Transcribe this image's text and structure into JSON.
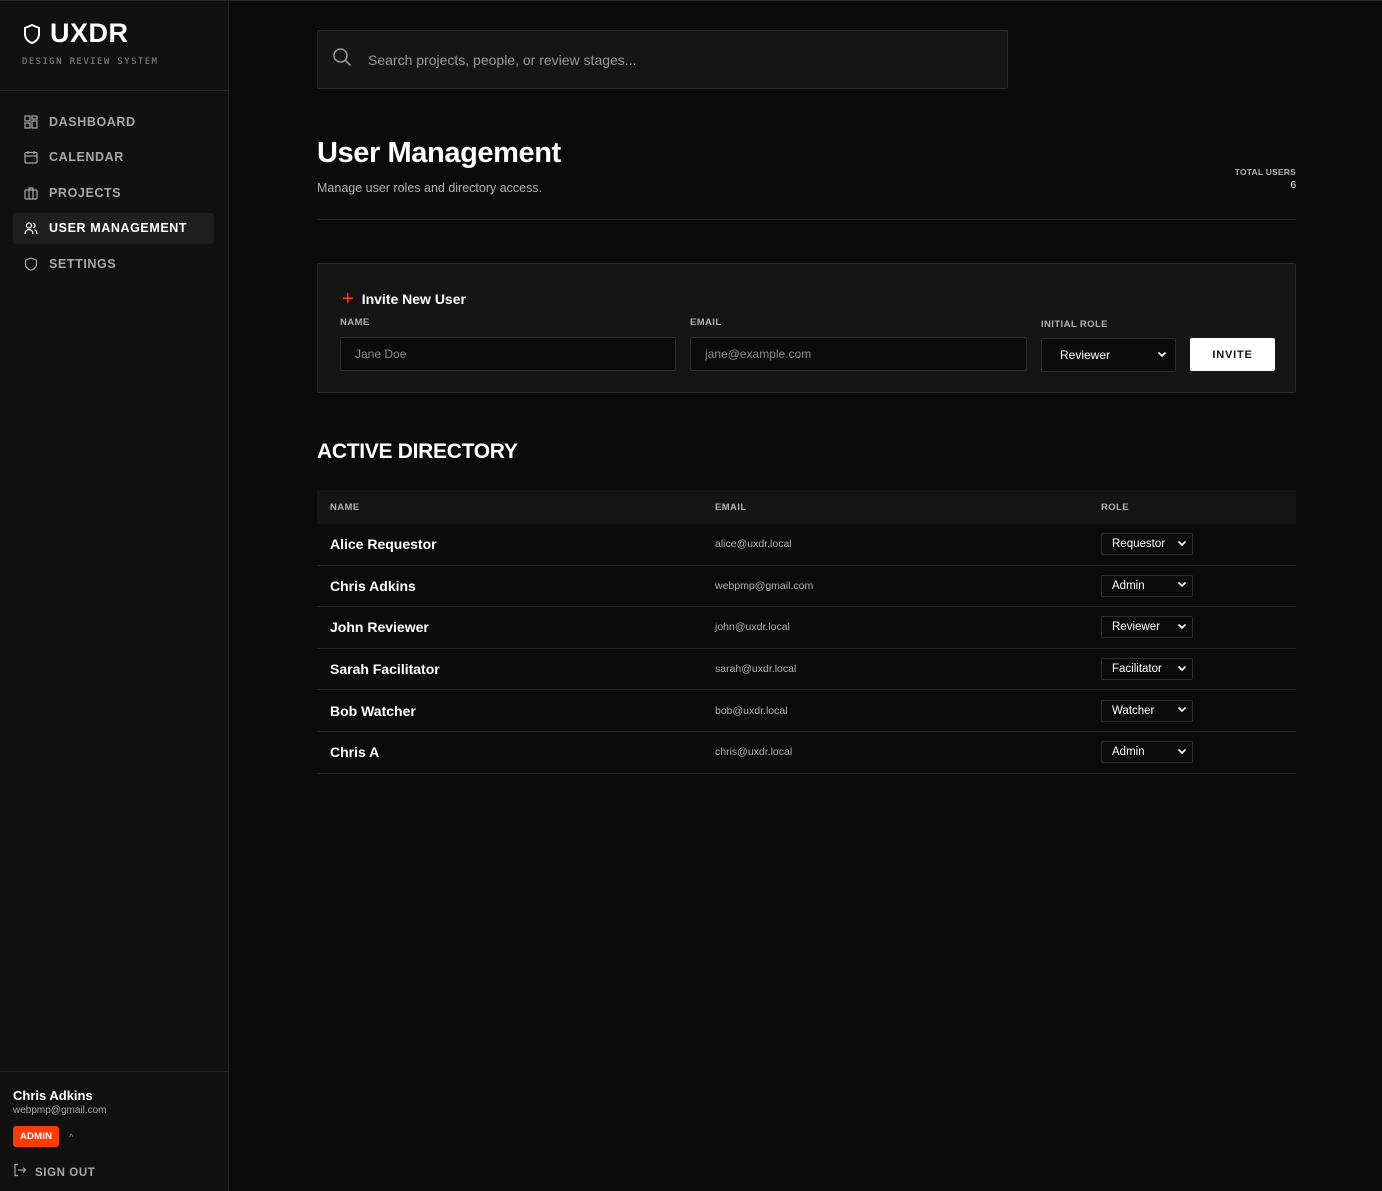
{
  "brand": {
    "name": "UXDR",
    "subtitle": "DESIGN REVIEW SYSTEM"
  },
  "nav": [
    {
      "label": "DASHBOARD",
      "icon": "grid-icon"
    },
    {
      "label": "CALENDAR",
      "icon": "calendar-icon"
    },
    {
      "label": "PROJECTS",
      "icon": "briefcase-icon"
    },
    {
      "label": "USER MANAGEMENT",
      "icon": "users-icon",
      "active": true
    },
    {
      "label": "SETTINGS",
      "icon": "shield-icon"
    }
  ],
  "current_user": {
    "name": "Chris Adkins",
    "email": "webpmp@gmail.com",
    "role_badge": "ADMIN",
    "caret": "^",
    "signout_label": "SIGN OUT"
  },
  "search": {
    "placeholder": "Search projects, people, or review stages..."
  },
  "header": {
    "title": "User Management",
    "subtitle": "Manage user roles and directory access.",
    "total_label": "TOTAL USERS",
    "total_value": "6"
  },
  "invite": {
    "title": "Invite New User",
    "plus": "+",
    "name_label": "NAME",
    "name_placeholder": "Jane Doe",
    "email_label": "EMAIL",
    "email_placeholder": "jane@example.com",
    "role_label": "INITIAL ROLE",
    "role_value": "Reviewer",
    "button_label": "INVITE"
  },
  "directory": {
    "title": "ACTIVE DIRECTORY",
    "columns": {
      "name": "NAME",
      "email": "EMAIL",
      "role": "ROLE"
    },
    "rows": [
      {
        "name": "Alice Requestor",
        "email": "alice@uxdr.local",
        "role": "Requestor"
      },
      {
        "name": "Chris Adkins",
        "email": "webpmp@gmail.com",
        "role": "Admin"
      },
      {
        "name": "John Reviewer",
        "email": "john@uxdr.local",
        "role": "Reviewer"
      },
      {
        "name": "Sarah Facilitator",
        "email": "sarah@uxdr.local",
        "role": "Facilitator"
      },
      {
        "name": "Bob Watcher",
        "email": "bob@uxdr.local",
        "role": "Watcher"
      },
      {
        "name": "Chris A",
        "email": "chris@uxdr.local",
        "role": "Admin"
      }
    ]
  },
  "colors": {
    "accent": "#ff3b0a",
    "background": "#0b0b0b",
    "sidebar": "#111111",
    "card": "#151515"
  }
}
